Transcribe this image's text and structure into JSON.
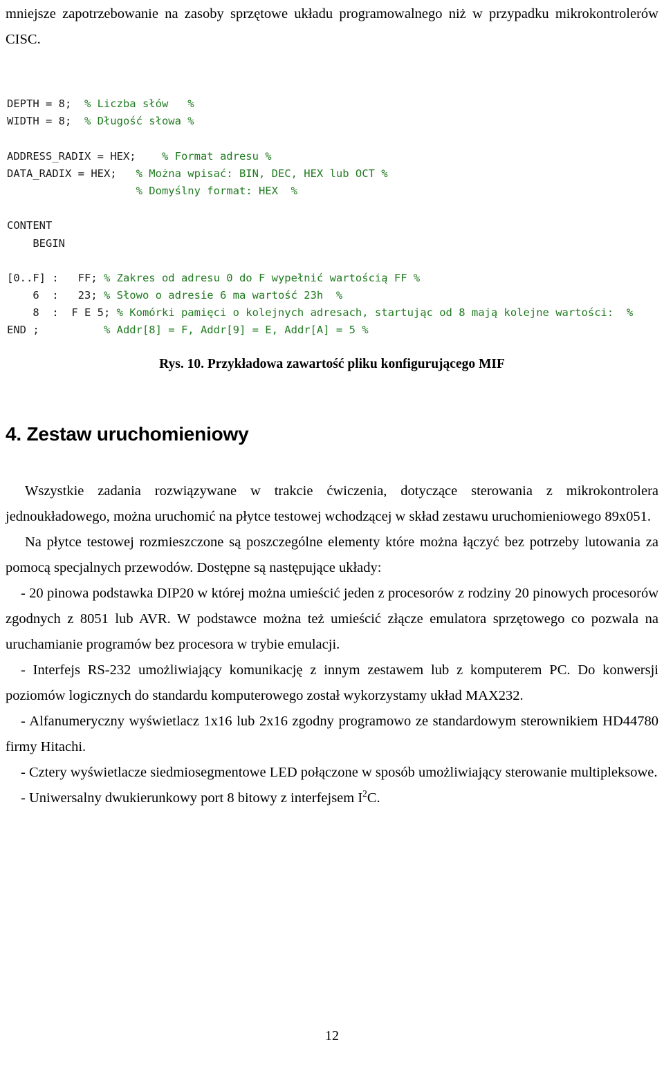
{
  "document": {
    "top_paragraph": "mniejsze zapotrzebowanie na zasoby sprzętowe układu programowalnego niż w przypadku mikrokontrolerów CISC.",
    "code_listing": [
      {
        "plain": "DEPTH = 8;  ",
        "green": "% Liczba słów   %"
      },
      {
        "plain": "WIDTH = 8;  ",
        "green": "% Długość słowa %"
      },
      {
        "plain": "",
        "green": ""
      },
      {
        "plain": "ADDRESS_RADIX = HEX;    ",
        "green": "% Format adresu %"
      },
      {
        "plain": "DATA_RADIX = HEX;   ",
        "green": "% Można wpisać: BIN, DEC, HEX lub OCT %"
      },
      {
        "plain": "                    ",
        "green": "% Domyślny format: HEX  %"
      },
      {
        "plain": "",
        "green": ""
      },
      {
        "plain": "CONTENT",
        "green": ""
      },
      {
        "plain": "    BEGIN",
        "green": ""
      },
      {
        "plain": "",
        "green": ""
      },
      {
        "plain": "[0..F] :   FF; ",
        "green": "% Zakres od adresu 0 do F wypełnić wartością FF %"
      },
      {
        "plain": "    6  :   23; ",
        "green": "% Słowo o adresie 6 ma wartość 23h  %"
      },
      {
        "plain": "    8  :  F E 5; ",
        "green": "% Komórki pamięci o kolejnych adresach, startując od 8 mają kolejne wartości:  %"
      },
      {
        "plain": "END ;          ",
        "green": "% Addr[8] = F, Addr[9] = E, Addr[A] = 5 %"
      }
    ],
    "figure_caption": "Rys. 10. Przykładowa zawartość pliku konfigurującego MIF",
    "section_heading": "4. Zestaw uruchomieniowy",
    "paragraphs": [
      "Wszystkie zadania rozwiązywane w trakcie ćwiczenia, dotyczące sterowania z mikrokontrolera jednoukładowego, można uruchomić na płytce testowej wchodzącej w skład zestawu uruchomieniowego 89x051.",
      "Na płytce testowej rozmieszczone są poszczególne elementy które można łączyć bez potrzeby lutowania za pomocą specjalnych przewodów. Dostępne są następujące układy:",
      "- 20 pinowa podstawka DIP20 w której można umieścić jeden z procesorów z rodziny 20 pinowych procesorów zgodnych z 8051 lub AVR. W podstawce można też umieścić złącze emulatora sprzętowego co pozwala na uruchamianie programów bez procesora w trybie emulacji.",
      "- Interfejs RS-232 umożliwiający komunikację z innym zestawem lub z komputerem PC. Do konwersji poziomów logicznych do standardu komputerowego został wykorzystamy układ MAX232.",
      "- Alfanumeryczny wyświetlacz 1x16 lub 2x16 zgodny programowo ze standardowym sterownikiem HD44780 firmy Hitachi.",
      "- Cztery wyświetlacze siedmiosegmentowe LED połączone w sposób umożliwiający sterowanie multipleksowe."
    ],
    "last_paragraph_prefix": "- Uniwersalny dwukierunkowy port 8 bitowy z interfejsem I",
    "last_paragraph_sup": "2",
    "last_paragraph_suffix": "C.",
    "page_number": "12",
    "colors": {
      "comment_green": "#1f7a1f",
      "text_black": "#000000",
      "background": "#ffffff"
    }
  }
}
